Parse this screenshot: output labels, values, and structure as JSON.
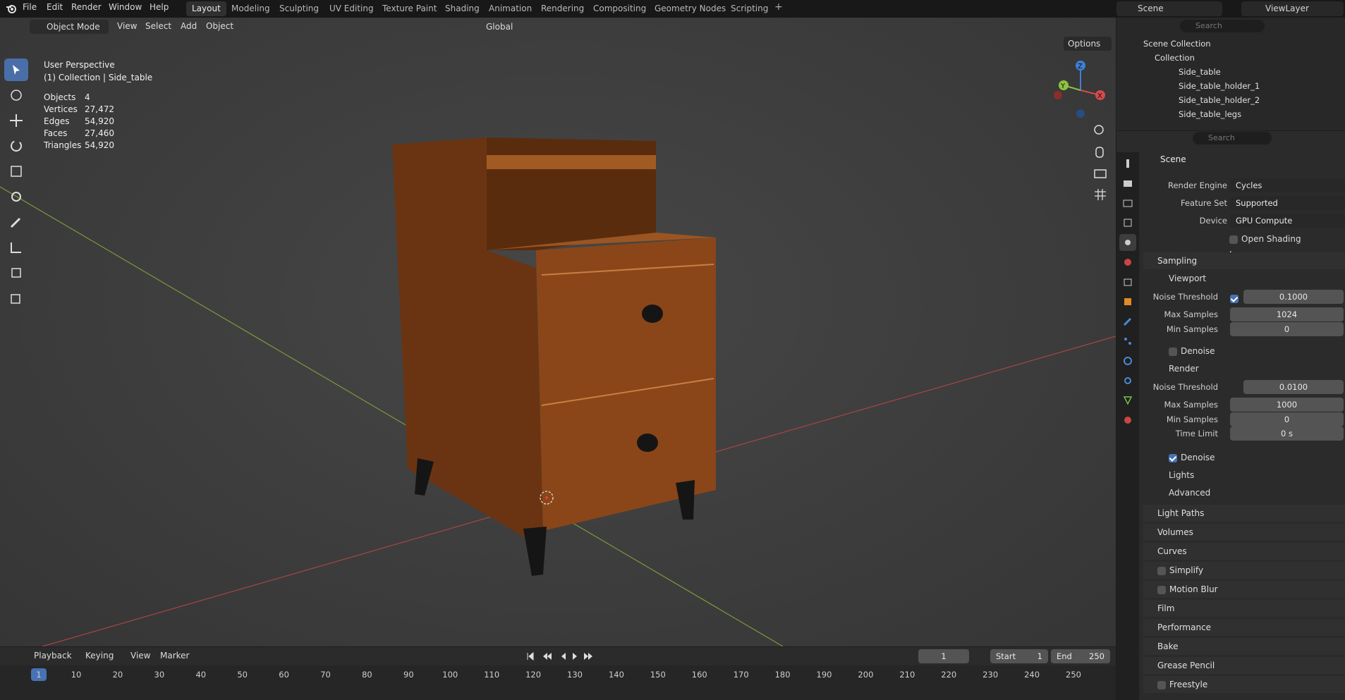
{
  "menu": [
    "File",
    "Edit",
    "Render",
    "Window",
    "Help"
  ],
  "workspaces": [
    "Layout",
    "Modeling",
    "Sculpting",
    "UV Editing",
    "Texture Paint",
    "Shading",
    "Animation",
    "Rendering",
    "Compositing",
    "Geometry Nodes",
    "Scripting"
  ],
  "active_workspace": "Layout",
  "top_right": {
    "scene": "Scene",
    "view_layer": "ViewLayer"
  },
  "viewport": {
    "mode": "Object Mode",
    "menus": [
      "View",
      "Select",
      "Add",
      "Object"
    ],
    "orientation": "Global",
    "options": "Options",
    "overlay_title": "User Perspective",
    "overlay_subtitle": "(1) Collection | Side_table",
    "stats": [
      {
        "label": "Objects",
        "value": "4"
      },
      {
        "label": "Vertices",
        "value": "27,472"
      },
      {
        "label": "Edges",
        "value": "54,920"
      },
      {
        "label": "Faces",
        "value": "27,460"
      },
      {
        "label": "Triangles",
        "value": "54,920"
      }
    ],
    "gizmo_axes": [
      "X",
      "Y",
      "Z"
    ]
  },
  "outliner": {
    "search_placeholder": "Search",
    "root": "Scene Collection",
    "collection": "Collection",
    "objects": [
      "Side_table",
      "Side_table_holder_1",
      "Side_table_holder_2",
      "Side_table_legs"
    ]
  },
  "properties": {
    "search_placeholder": "Search",
    "context": "Scene",
    "render_engine_label": "Render Engine",
    "render_engine": "Cycles",
    "feature_set_label": "Feature Set",
    "feature_set": "Supported",
    "device_label": "Device",
    "device": "GPU Compute",
    "osl_label": "Open Shading Language",
    "sampling": "Sampling",
    "viewport": "Viewport",
    "noise_threshold_label": "Noise Threshold",
    "viewport_noise": "0.1000",
    "max_samples_label": "Max Samples",
    "viewport_max": "1024",
    "min_samples_label": "Min Samples",
    "viewport_min": "0",
    "denoise_label": "Denoise",
    "render": "Render",
    "render_noise": "0.0100",
    "render_max": "1000",
    "render_min": "0",
    "time_limit_label": "Time Limit",
    "time_limit": "0 s",
    "lights": "Lights",
    "advanced": "Advanced",
    "panels": [
      "Light Paths",
      "Volumes",
      "Curves",
      "Simplify",
      "Motion Blur",
      "Film",
      "Performance",
      "Bake",
      "Grease Pencil",
      "Freestyle"
    ]
  },
  "timeline": {
    "menus": [
      "Playback",
      "Keying",
      "View",
      "Marker"
    ],
    "current_frame": "1",
    "start_label": "Start",
    "start": "1",
    "end_label": "End",
    "end": "250",
    "ticks": [
      "1",
      "10",
      "20",
      "30",
      "40",
      "50",
      "60",
      "70",
      "80",
      "90",
      "100",
      "110",
      "120",
      "130",
      "140",
      "150",
      "160",
      "170",
      "180",
      "190",
      "200",
      "210",
      "220",
      "230",
      "240",
      "250"
    ]
  },
  "colors": {
    "accent": "#4772b3",
    "x_axis": "#d64a4a",
    "y_axis": "#8fc23f",
    "z_axis": "#3f7fd6",
    "wood": "#7a3f16"
  }
}
